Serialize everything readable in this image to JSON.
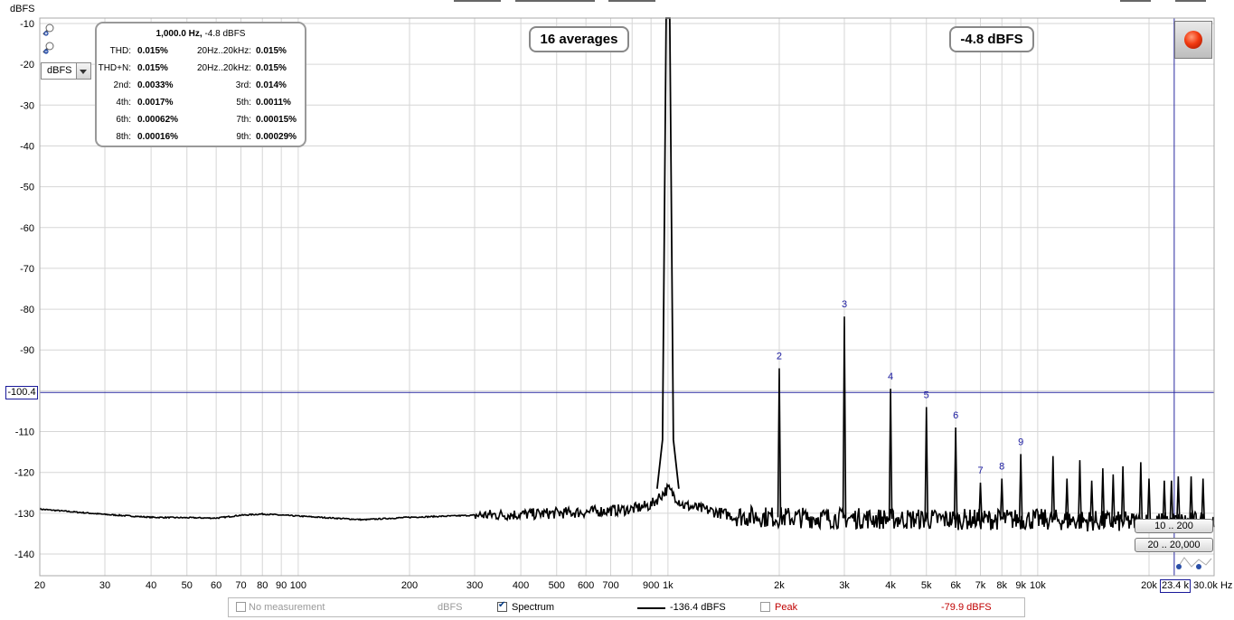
{
  "chart_data": {
    "type": "line",
    "title": "",
    "xlabel": "Hz",
    "ylabel": "dBFS",
    "x_scale": "log",
    "xlim": [
      20,
      30000
    ],
    "ylim": [
      -145,
      -8
    ],
    "grid": true,
    "y_ticks": [
      "-10",
      "-20",
      "-30",
      "-40",
      "-50",
      "-60",
      "-70",
      "-80",
      "-90",
      "-100",
      "-110",
      "-120",
      "-130",
      "-140"
    ],
    "x_ticks": [
      "20",
      "30",
      "40",
      "50",
      "60",
      "70",
      "80",
      "90",
      "100",
      "200",
      "300",
      "400",
      "500",
      "600",
      "700",
      "900",
      "1k",
      "2k",
      "3k",
      "4k",
      "5k",
      "6k",
      "7k",
      "8k",
      "9k",
      "10k",
      "20k",
      "30.0k Hz"
    ],
    "x_tick_values": [
      20,
      30,
      40,
      50,
      60,
      70,
      80,
      90,
      100,
      200,
      300,
      400,
      500,
      600,
      700,
      900,
      1000,
      2000,
      3000,
      4000,
      5000,
      6000,
      7000,
      8000,
      9000,
      10000,
      20000,
      30000
    ],
    "series": [
      {
        "color": "#000000",
        "noise_floor": [
          [
            20,
            -129
          ],
          [
            30,
            -130.3
          ],
          [
            40,
            -131
          ],
          [
            50,
            -131.1
          ],
          [
            60,
            -131.2
          ],
          [
            70,
            -130.5
          ],
          [
            80,
            -130.2
          ],
          [
            100,
            -130.7
          ],
          [
            150,
            -131.6
          ],
          [
            200,
            -131
          ],
          [
            300,
            -130.5
          ],
          [
            400,
            -130.3
          ],
          [
            600,
            -129.7
          ],
          [
            800,
            -129
          ],
          [
            900,
            -128
          ],
          [
            1000,
            -124
          ],
          [
            1100,
            -128
          ],
          [
            1500,
            -130.6
          ],
          [
            2000,
            -131
          ],
          [
            5000,
            -131.5
          ],
          [
            10000,
            -131.5
          ],
          [
            20000,
            -132.3
          ],
          [
            30000,
            -132
          ]
        ],
        "peaks": [
          {
            "freq": 1000,
            "level": -4.8
          },
          {
            "freq": 2000,
            "level": -94.5
          },
          {
            "freq": 3000,
            "level": -81.8
          },
          {
            "freq": 4000,
            "level": -99.5
          },
          {
            "freq": 5000,
            "level": -104
          },
          {
            "freq": 6000,
            "level": -109
          },
          {
            "freq": 7000,
            "level": -122.5
          },
          {
            "freq": 8000,
            "level": -121.5
          },
          {
            "freq": 9000,
            "level": -115.5
          },
          {
            "freq": 11000,
            "level": -116
          },
          {
            "freq": 12000,
            "level": -121.5
          },
          {
            "freq": 13000,
            "level": -117
          },
          {
            "freq": 14000,
            "level": -122
          },
          {
            "freq": 15000,
            "level": -119
          },
          {
            "freq": 16000,
            "level": -120.5
          },
          {
            "freq": 17000,
            "level": -118.5
          },
          {
            "freq": 19000,
            "level": -117.5
          },
          {
            "freq": 20000,
            "level": -121.5
          },
          {
            "freq": 22000,
            "level": -122
          },
          {
            "freq": 23000,
            "level": -122
          },
          {
            "freq": 24000,
            "level": -121
          },
          {
            "freq": 26000,
            "level": -121
          },
          {
            "freq": 28000,
            "level": -121.5
          }
        ]
      }
    ],
    "harmonic_labels": [
      {
        "label": "2",
        "freq": 2000,
        "level": -94.5
      },
      {
        "label": "3",
        "freq": 3000,
        "level": -81.8
      },
      {
        "label": "4",
        "freq": 4000,
        "level": -99.5
      },
      {
        "label": "5",
        "freq": 5000,
        "level": -104
      },
      {
        "label": "6",
        "freq": 6000,
        "level": -109
      },
      {
        "label": "7",
        "freq": 7000,
        "level": -122.5
      },
      {
        "label": "8",
        "freq": 8000,
        "level": -121.5
      },
      {
        "label": "9",
        "freq": 9000,
        "level": -115.5
      }
    ],
    "cursor": {
      "x_label": "23.4 k",
      "y_label": "-100.4",
      "freq": 23400,
      "level": -100.4
    }
  },
  "stats": {
    "title_bold": "1,000.0 Hz,",
    "title_rest": " -4.8 dBFS",
    "rows": [
      {
        "l1": "THD:",
        "v1": "0.015%",
        "l2": "20Hz..20kHz:",
        "v2": "0.015%"
      },
      {
        "l1": "THD+N:",
        "v1": "0.015%",
        "l2": "20Hz..20kHz:",
        "v2": "0.015%"
      },
      {
        "l1": "2nd:",
        "v1": "0.0033%",
        "l2": "3rd:",
        "v2": "0.014%"
      },
      {
        "l1": "4th:",
        "v1": "0.0017%",
        "l2": "5th:",
        "v2": "0.0011%"
      },
      {
        "l1": "6th:",
        "v1": "0.00062%",
        "l2": "7th:",
        "v2": "0.00015%"
      },
      {
        "l1": "8th:",
        "v1": "0.00016%",
        "l2": "9th:",
        "v2": "0.00029%"
      }
    ]
  },
  "averages_badge": "16 averages",
  "level_badge": "-4.8 dBFS",
  "unit_select": "dBFS",
  "range_buttons": {
    "low": "10 .. 200",
    "high": "20 .. 20,000"
  },
  "legend": {
    "no_measurement": "No measurement",
    "units": "dBFS",
    "spectrum": "Spectrum",
    "spectrum_value": "-136.4 dBFS",
    "peak": "Peak",
    "peak_value": "-79.9 dBFS"
  },
  "colors": {
    "grid": "#d6d6d6",
    "cursor": "#2a2aa0",
    "harmonic_label": "#1a1aa0",
    "peak": "#c00000"
  }
}
